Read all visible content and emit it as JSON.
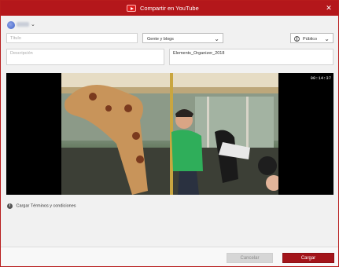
{
  "window": {
    "title": "Compartir en YouTube",
    "close_glyph": "✕",
    "accent": "#b4171b"
  },
  "account": {
    "chevron": "⌄"
  },
  "form": {
    "title_placeholder": "Título",
    "category": "Gente y blogs",
    "privacy": "Público",
    "description_placeholder": "Descripción",
    "tags_value": "Elements_Organizer_2018"
  },
  "video": {
    "timecode": "00:14:37"
  },
  "terms": {
    "label": "Cargar Términos y condiciones",
    "icon": "info-icon"
  },
  "buttons": {
    "cancel": "Cancelar",
    "upload": "Cargar"
  }
}
